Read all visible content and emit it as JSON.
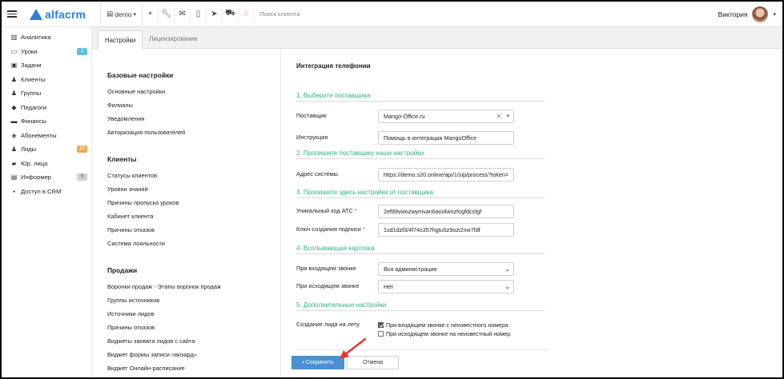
{
  "topbar": {
    "logo_text": "alfacrm",
    "branch_label": "demo",
    "search_placeholder": "Поиск клиента",
    "user_name": "Виктория",
    "icons": [
      "plus-icon",
      "wrench-icon",
      "mail-icon",
      "phone-icon",
      "telegram-icon",
      "cart-icon",
      "bell-icon"
    ]
  },
  "sidebar": {
    "items": [
      {
        "label": "Аналитика",
        "icon": "analytics-icon"
      },
      {
        "label": "Уроки",
        "icon": "calendar-icon",
        "badge": "2",
        "badge_color": "#5bc0de"
      },
      {
        "label": "Задачи",
        "icon": "tasks-icon"
      },
      {
        "label": "Клиенты",
        "icon": "user-icon"
      },
      {
        "label": "Группы",
        "icon": "users-icon"
      },
      {
        "label": "Педагоги",
        "icon": "graduation-icon"
      },
      {
        "label": "Финансы",
        "icon": "money-icon"
      },
      {
        "label": "Абонементы",
        "icon": "tag-icon"
      },
      {
        "label": "Лиды",
        "icon": "user-plus-icon",
        "badge": "10",
        "badge_color": "#f0ad4e"
      },
      {
        "label": "Юр. лица",
        "icon": "briefcase-icon"
      },
      {
        "label": "Информер",
        "icon": "inbox-icon",
        "badge": "5",
        "badge_color": "#d0d0d0"
      },
      {
        "label": "Доступ в CRM",
        "icon": "lock-icon"
      }
    ]
  },
  "tabs": [
    {
      "label": "Настройки",
      "active": true
    },
    {
      "label": "Лицензирование",
      "active": false
    }
  ],
  "settings_nav": {
    "groups": [
      {
        "heading": "Базовые настройки",
        "links": [
          "Основные настройки",
          "Филиалы",
          "Уведомления",
          "Авторизация пользователей"
        ]
      },
      {
        "heading": "Клиенты",
        "links": [
          "Статусы клиентов",
          "Уровни знаний",
          "Причины пропуска уроков",
          "Кабинет клиента",
          "Причины отказов",
          "Система лояльности"
        ]
      },
      {
        "heading": "Продажи",
        "links": [
          "Воронки продаж - Этапы воронок продаж",
          "Группы источников",
          "Источники лидов",
          "Причины отказов",
          "Виджеты захвата лидов с сайта",
          "Виджет формы записи «визард»",
          "Виджет Онлайн-расписание"
        ]
      }
    ]
  },
  "form": {
    "title": "Интеграция телефонии",
    "sections": {
      "s1": "1. Выберите поставщика",
      "s2": "2. Пропишите поставщику наши настройки",
      "s3": "3. Пропишите здесь настройки от поставщика",
      "s4": "4. Всплывающая карточка",
      "s5": "5. Дополнительные настройки"
    },
    "provider_label": "Поставщик",
    "provider_value": "Mango-Office.ru",
    "instruction_label": "Инструкция",
    "instruction_value": "Помощь в интеграции MangoOffice",
    "system_address_label": "Адрес системы",
    "system_address_value": "https://demo.s20.online/api/1/sip/process?token=",
    "ats_code_label": "Уникальный код АТС",
    "ats_code_value": "2ef89vwozwymvan6aoolwnzfogfdcsfgf",
    "signature_key_label": "Ключ создания подписи",
    "signature_key_value": "1sd1dzf3/4f74s357hgtu5z9ozi2nw7fdf",
    "incoming_label": "При входящем звонке",
    "incoming_value": "Вся администрация",
    "outgoing_label": "При исходящем звонке",
    "outgoing_value": "Нет",
    "create_lead_label": "Создание лида на лету",
    "check_incoming_label": "При входящем звонке с неизвестного номера",
    "check_incoming_checked": true,
    "check_outgoing_label": "При исходящем звонке на неизвестный номер",
    "check_outgoing_checked": false,
    "save_label": "Сохранить",
    "cancel_label": "Отмена"
  },
  "colors": {
    "accent": "#2e7fd9",
    "section_green": "#2bb07f",
    "save_button": "#4a90d2",
    "arrow": "#e53935"
  }
}
